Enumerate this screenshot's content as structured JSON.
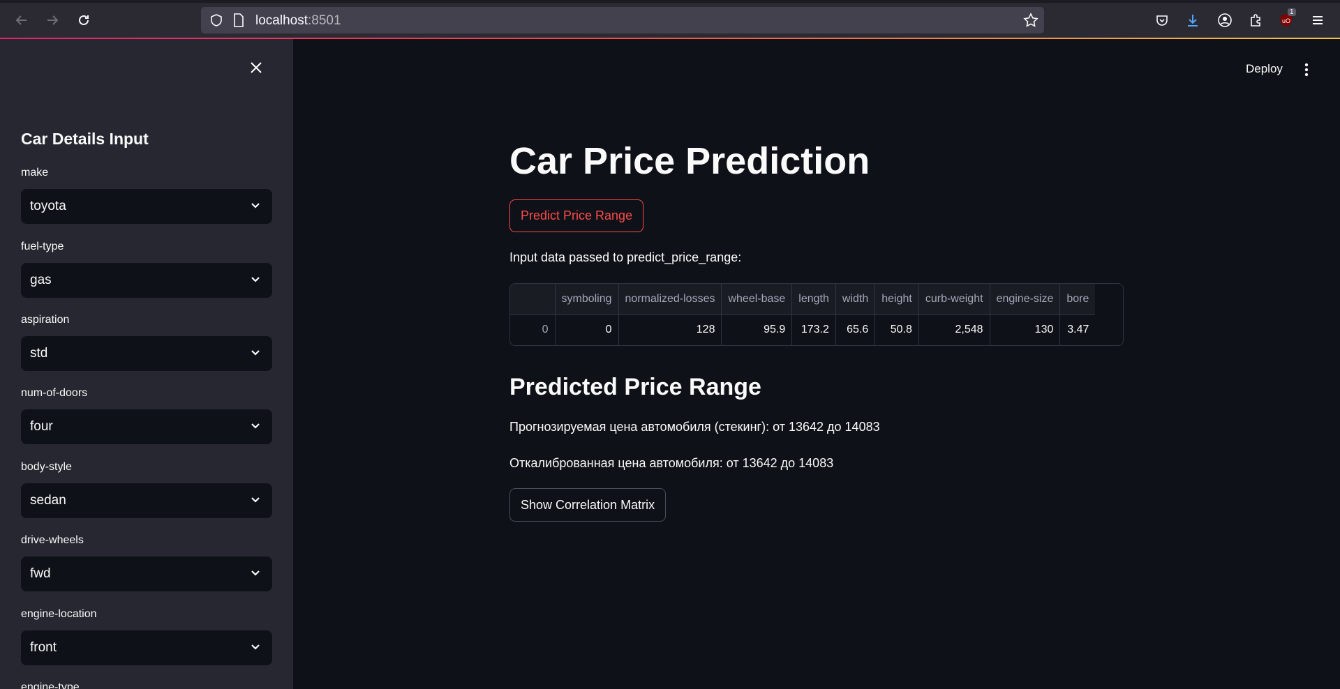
{
  "browser": {
    "url_host": "localhost",
    "url_port": ":8501",
    "download_badge": "1"
  },
  "sidebar": {
    "title": "Car Details Input",
    "fields": [
      {
        "label": "make",
        "value": "toyota"
      },
      {
        "label": "fuel-type",
        "value": "gas"
      },
      {
        "label": "aspiration",
        "value": "std"
      },
      {
        "label": "num-of-doors",
        "value": "four"
      },
      {
        "label": "body-style",
        "value": "sedan"
      },
      {
        "label": "drive-wheels",
        "value": "fwd"
      },
      {
        "label": "engine-location",
        "value": "front"
      },
      {
        "label": "engine-type",
        "value": ""
      }
    ]
  },
  "header": {
    "deploy_label": "Deploy"
  },
  "main": {
    "title": "Car Price Prediction",
    "predict_button": "Predict Price Range",
    "input_note": "Input data passed to predict_price_range:",
    "table": {
      "columns": [
        "",
        "symboling",
        "normalized-losses",
        "wheel-base",
        "length",
        "width",
        "height",
        "curb-weight",
        "engine-size",
        "bore"
      ],
      "rows": [
        [
          "0",
          "0",
          "128",
          "95.9",
          "173.2",
          "65.6",
          "50.8",
          "2,548",
          "130",
          "3.47"
        ]
      ]
    },
    "predicted_heading": "Predicted Price Range",
    "prediction_stacking": "Прогнозируемая цена автомобиля (стекинг): от 13642 до 14083",
    "prediction_calibrated": "Откалиброванная цена автомобиля: от 13642 до 14083",
    "correlation_button": "Show Correlation Matrix"
  },
  "colors": {
    "accent": "#ff4b4b",
    "background": "#0e1117",
    "sidebar": "#262730"
  }
}
